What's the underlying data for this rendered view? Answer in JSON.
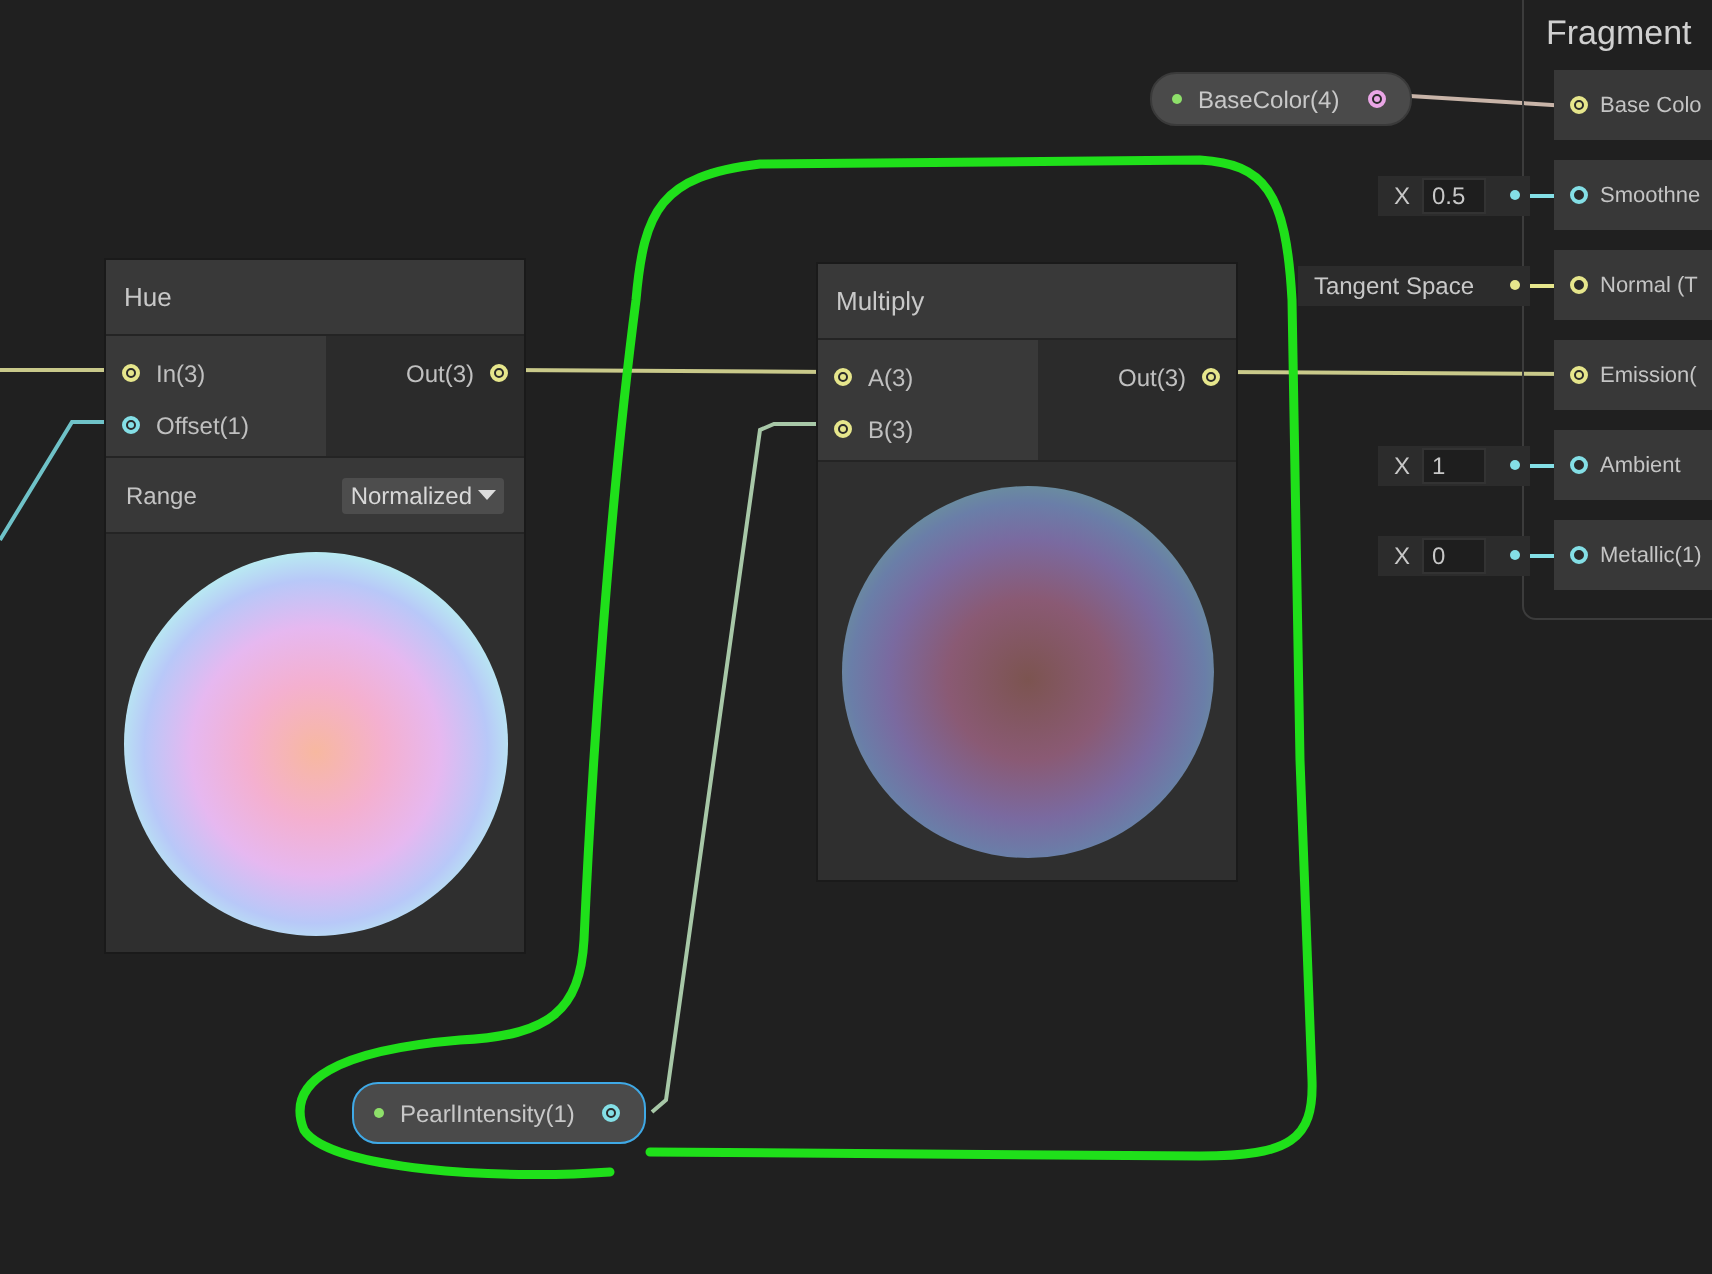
{
  "hue_node": {
    "title": "Hue",
    "inputs": [
      {
        "label": "In(3)",
        "color": "#e6e68c",
        "connected": true
      },
      {
        "label": "Offset(1)",
        "color": "#84dfe6",
        "connected": true
      }
    ],
    "outputs": [
      {
        "label": "Out(3)",
        "color": "#e6e68c",
        "connected": true
      }
    ],
    "range": {
      "label": "Range",
      "value": "Normalized"
    }
  },
  "multiply_node": {
    "title": "Multiply",
    "inputs": [
      {
        "label": "A(3)",
        "color": "#e6e68c",
        "connected": true
      },
      {
        "label": "B(3)",
        "color": "#e6e68c",
        "connected": true
      }
    ],
    "outputs": [
      {
        "label": "Out(3)",
        "color": "#e6e68c",
        "connected": true
      }
    ]
  },
  "base_color_property": {
    "label": "BaseColor(4)",
    "color": "#eaa6e6",
    "selected": false
  },
  "pearl_intensity_property": {
    "label": "PearlIntensity(1)",
    "color": "#84dfe6",
    "selected": true
  },
  "fragment": {
    "title": "Fragment",
    "rows": [
      {
        "label": "Base Colo",
        "color": "#e6e68c",
        "connected": true
      },
      {
        "label": "Smoothne",
        "color": "#84dfe6",
        "connected": false,
        "input": {
          "kind": "float",
          "axis": "X",
          "value": "0.5"
        }
      },
      {
        "label": "Normal (T",
        "color": "#e6e68c",
        "connected": false,
        "input": {
          "kind": "space",
          "text": "Tangent Space"
        }
      },
      {
        "label": "Emission(",
        "color": "#e6e68c",
        "connected": true
      },
      {
        "label": "Ambient",
        "color": "#84dfe6",
        "connected": false,
        "input": {
          "kind": "float",
          "axis": "X",
          "value": "1"
        }
      },
      {
        "label": "Metallic(1)",
        "color": "#84dfe6",
        "connected": false,
        "input": {
          "kind": "float",
          "axis": "X",
          "value": "0"
        }
      }
    ]
  }
}
